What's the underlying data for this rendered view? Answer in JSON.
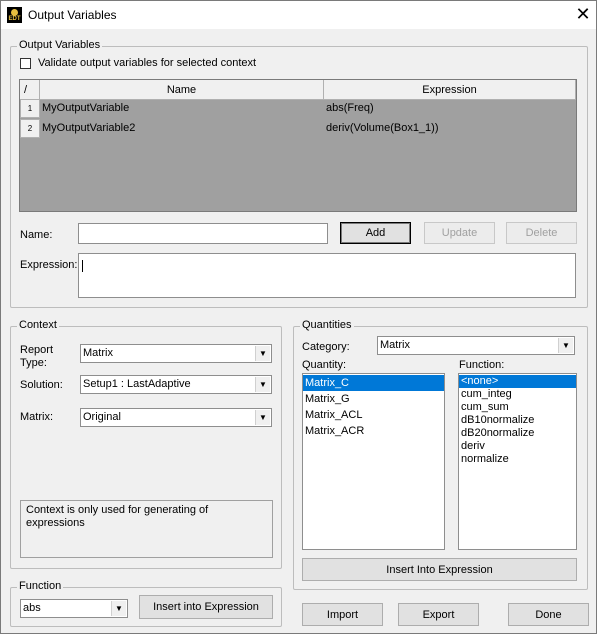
{
  "window": {
    "title": "Output Variables",
    "icon_text": "EDT"
  },
  "output_group": {
    "legend": "Output Variables",
    "validate_label": "Validate output variables for selected context",
    "table": {
      "corner": "/",
      "headers": [
        "Name",
        "Expression"
      ],
      "rows": [
        {
          "num": "1",
          "name": "MyOutputVariable",
          "expression": "abs(Freq)"
        },
        {
          "num": "2",
          "name": "MyOutputVariable2",
          "expression": "deriv(Volume(Box1_1))"
        }
      ]
    },
    "name_label": "Name:",
    "name_value": "",
    "expression_label": "Expression:",
    "expression_value": "",
    "add_label": "Add",
    "update_label": "Update",
    "delete_label": "Delete"
  },
  "context_group": {
    "legend": "Context",
    "report_type_label_1": "Report",
    "report_type_label_2": "Type:",
    "report_type_value": "Matrix",
    "solution_label": "Solution:",
    "solution_value": "Setup1 : LastAdaptive",
    "matrix_label": "Matrix:",
    "matrix_value": "Original",
    "note": "Context is only used for generating of expressions"
  },
  "quantities_group": {
    "legend": "Quantities",
    "category_label": "Category:",
    "category_value": "Matrix",
    "quantity_label": "Quantity:",
    "function_label": "Function:",
    "quantities": [
      "Matrix_C",
      "Matrix_G",
      "Matrix_ACL",
      "Matrix_ACR"
    ],
    "selected_quantity": "Matrix_C",
    "functions": [
      "<none>",
      "cum_integ",
      "cum_sum",
      "dB10normalize",
      "dB20normalize",
      "deriv",
      "normalize"
    ],
    "selected_function": "<none>",
    "insert_label": "Insert Into Expression"
  },
  "function_group": {
    "legend": "Function",
    "function_value": "abs",
    "insert_label": "Insert into Expression"
  },
  "footer": {
    "import_label": "Import",
    "export_label": "Export",
    "done_label": "Done"
  },
  "colors": {
    "selection": "#0078d7",
    "grid_bg": "#a0a0a0"
  }
}
